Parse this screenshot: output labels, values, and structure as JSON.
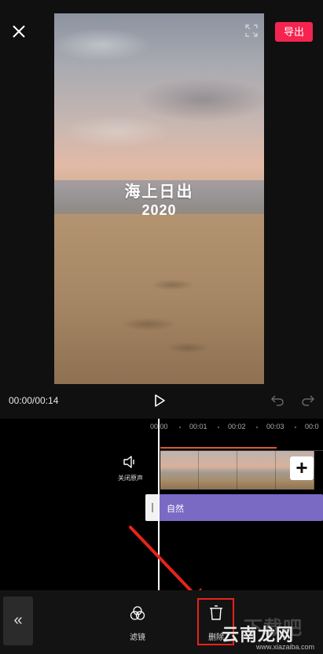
{
  "header": {
    "close_icon": "close-icon",
    "export_label": "导出",
    "export_color": "#f5244f"
  },
  "video": {
    "title_line1": "海上日出",
    "title_line2": "2020",
    "fullscreen_icon": "fullscreen-icon"
  },
  "playback": {
    "time": "00:00/00:14",
    "play_icon": "play-icon",
    "undo_icon": "undo-icon",
    "redo_icon": "redo-icon"
  },
  "timeline": {
    "ruler": [
      "00:00",
      "00:01",
      "00:02",
      "00:03",
      "00:0"
    ],
    "mute_label": "关闭原声",
    "mute_icon": "speaker-icon",
    "add_icon": "plus-icon",
    "filter_label": "自然",
    "filter_color": "#7b6ac4",
    "clip_accent": "#e05a28"
  },
  "toolbar": {
    "back_icon": "double-chevron-left-icon",
    "filter_tool_label": "滤镜",
    "filter_tool_icon": "filter-icon",
    "delete_tool_label": "删除",
    "delete_tool_icon": "delete-icon",
    "highlight_color": "#e8231b"
  },
  "watermark": {
    "big_text": "下载吧",
    "site_text": "云南龙网",
    "url_text": "www.xiazaiba.com"
  }
}
